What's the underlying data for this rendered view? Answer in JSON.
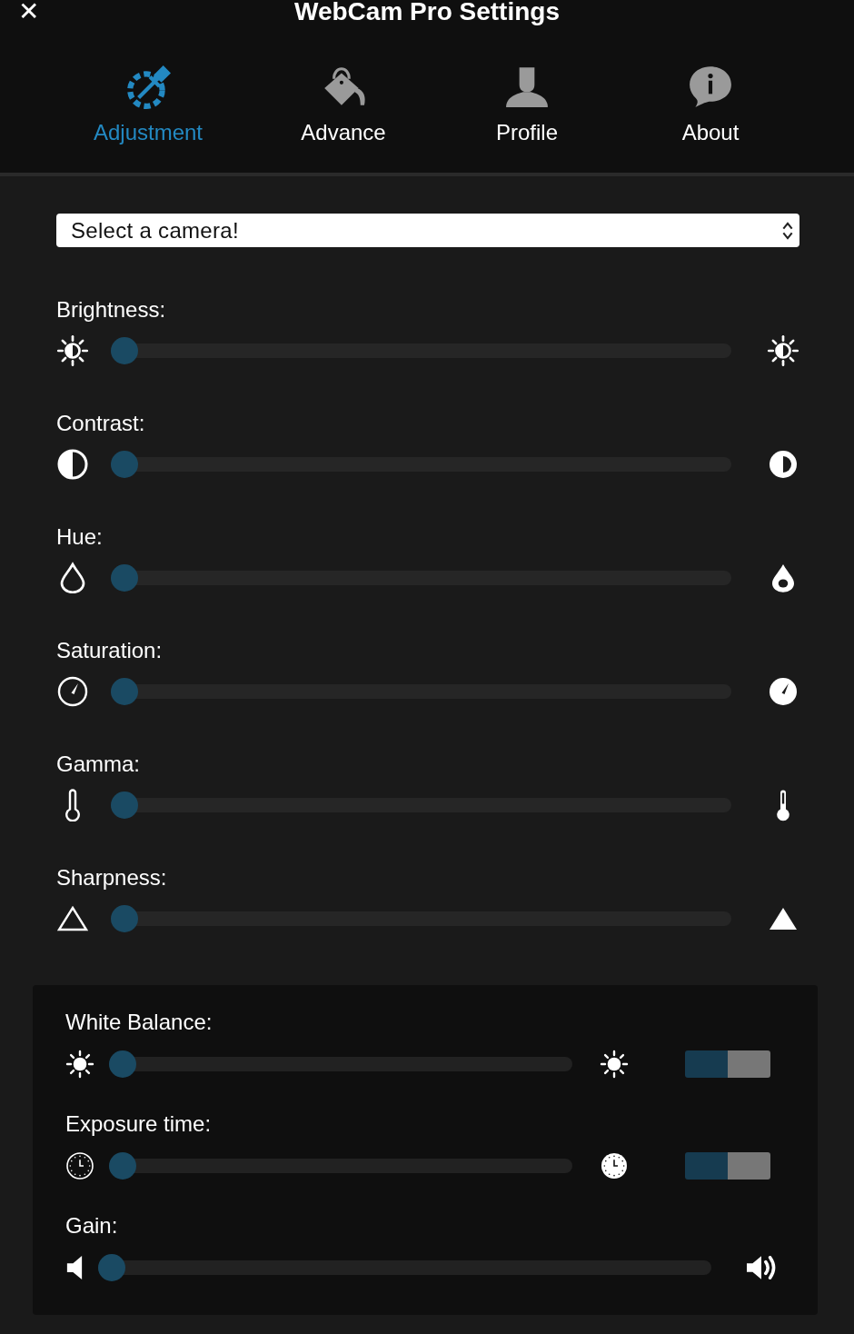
{
  "window": {
    "title": "WebCam Pro Settings",
    "close": "✕"
  },
  "tabs": [
    {
      "label": "Adjustment",
      "selected": true
    },
    {
      "label": "Advance",
      "selected": false
    },
    {
      "label": "Profile",
      "selected": false
    },
    {
      "label": "About",
      "selected": false
    }
  ],
  "camera_select": {
    "value": "Select a camera!"
  },
  "sliders": [
    {
      "label": "Brightness:",
      "level": 0
    },
    {
      "label": "Contrast:",
      "level": 0
    },
    {
      "label": "Hue:",
      "level": 0
    },
    {
      "label": "Saturation:",
      "level": 0
    },
    {
      "label": "Gamma:",
      "level": 0
    },
    {
      "label": "Sharpness:",
      "level": 0
    }
  ],
  "auto_panel": [
    {
      "label": "White Balance:",
      "level": 0,
      "kind": "switch",
      "auto_on": true
    },
    {
      "label": "Exposure time:",
      "level": 0,
      "kind": "switch",
      "auto_on": true
    },
    {
      "label": "Gain:",
      "level": 0,
      "kind": "plain"
    }
  ]
}
